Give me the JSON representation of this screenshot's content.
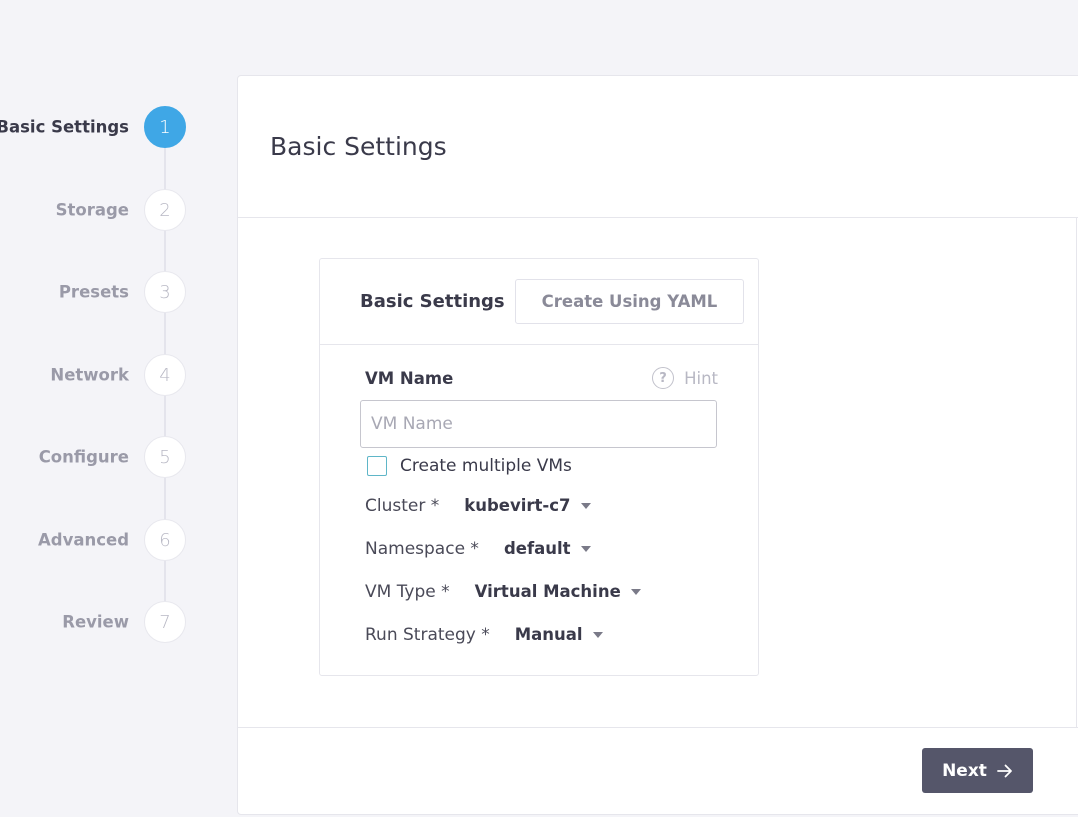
{
  "steps": [
    {
      "label": "Basic Settings",
      "number": "1",
      "active": true
    },
    {
      "label": "Storage",
      "number": "2",
      "active": false
    },
    {
      "label": "Presets",
      "number": "3",
      "active": false
    },
    {
      "label": "Network",
      "number": "4",
      "active": false
    },
    {
      "label": "Configure",
      "number": "5",
      "active": false
    },
    {
      "label": "Advanced",
      "number": "6",
      "active": false
    },
    {
      "label": "Review",
      "number": "7",
      "active": false
    }
  ],
  "panel": {
    "title": "Basic Settings"
  },
  "card": {
    "tab_active": "Basic Settings",
    "tab_yaml": "Create Using YAML",
    "vm_name_label": "VM Name",
    "hint_icon": "?",
    "hint_label": "Hint",
    "vm_name_placeholder": "VM Name",
    "vm_name_value": "",
    "create_multiple_label": "Create multiple VMs",
    "create_multiple_checked": false,
    "selects": [
      {
        "label": "Cluster *",
        "value": "kubevirt-c7"
      },
      {
        "label": "Namespace *",
        "value": "default"
      },
      {
        "label": "VM Type *",
        "value": "Virtual Machine"
      },
      {
        "label": "Run Strategy *",
        "value": "Manual"
      }
    ]
  },
  "footer": {
    "next_label": "Next"
  },
  "colors": {
    "active_step": "#3fa7e6",
    "next_button": "#55566a",
    "checkbox_border": "#5fb6c8"
  }
}
